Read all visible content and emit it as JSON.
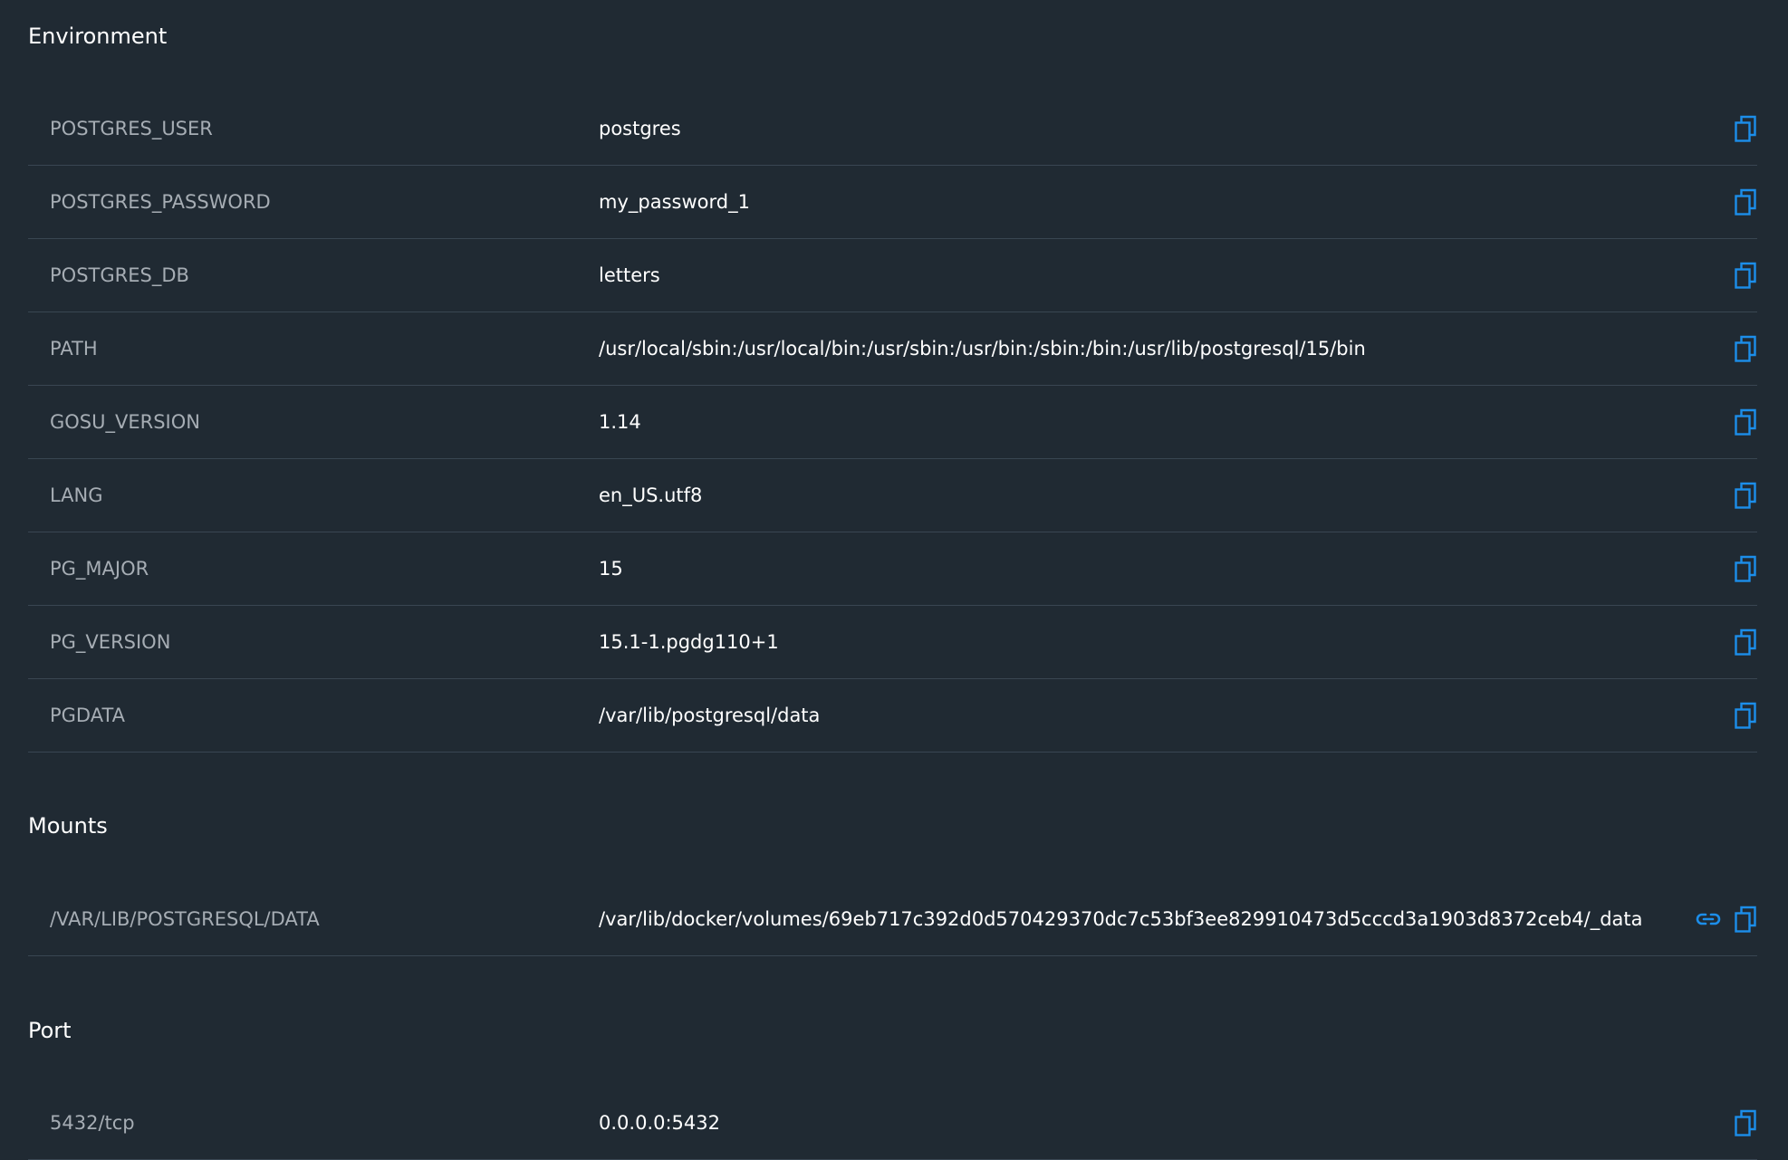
{
  "environment": {
    "title": "Environment",
    "rows": [
      {
        "key": "POSTGRES_USER",
        "value": "postgres"
      },
      {
        "key": "POSTGRES_PASSWORD",
        "value": "my_password_1"
      },
      {
        "key": "POSTGRES_DB",
        "value": "letters"
      },
      {
        "key": "PATH",
        "value": "/usr/local/sbin:/usr/local/bin:/usr/sbin:/usr/bin:/sbin:/bin:/usr/lib/postgresql/15/bin"
      },
      {
        "key": "GOSU_VERSION",
        "value": "1.14"
      },
      {
        "key": "LANG",
        "value": "en_US.utf8"
      },
      {
        "key": "PG_MAJOR",
        "value": "15"
      },
      {
        "key": "PG_VERSION",
        "value": "15.1-1.pgdg110+1"
      },
      {
        "key": "PGDATA",
        "value": "/var/lib/postgresql/data"
      }
    ]
  },
  "mounts": {
    "title": "Mounts",
    "rows": [
      {
        "key": "/VAR/LIB/POSTGRESQL/DATA",
        "value": "/var/lib/docker/volumes/69eb717c392d0d570429370dc7c53bf3ee829910473d5cccd3a1903d8372ceb4/_data"
      }
    ]
  },
  "port": {
    "title": "Port",
    "rows": [
      {
        "key": "5432/tcp",
        "value": "0.0.0.0:5432"
      }
    ]
  },
  "icons": {
    "copy": "copy-icon",
    "link": "link-icon"
  },
  "colors": {
    "background": "#202a33",
    "accent": "#1c8eea",
    "key_text": "#a6adb4",
    "value_text": "#ffffff",
    "divider": "#394652"
  }
}
